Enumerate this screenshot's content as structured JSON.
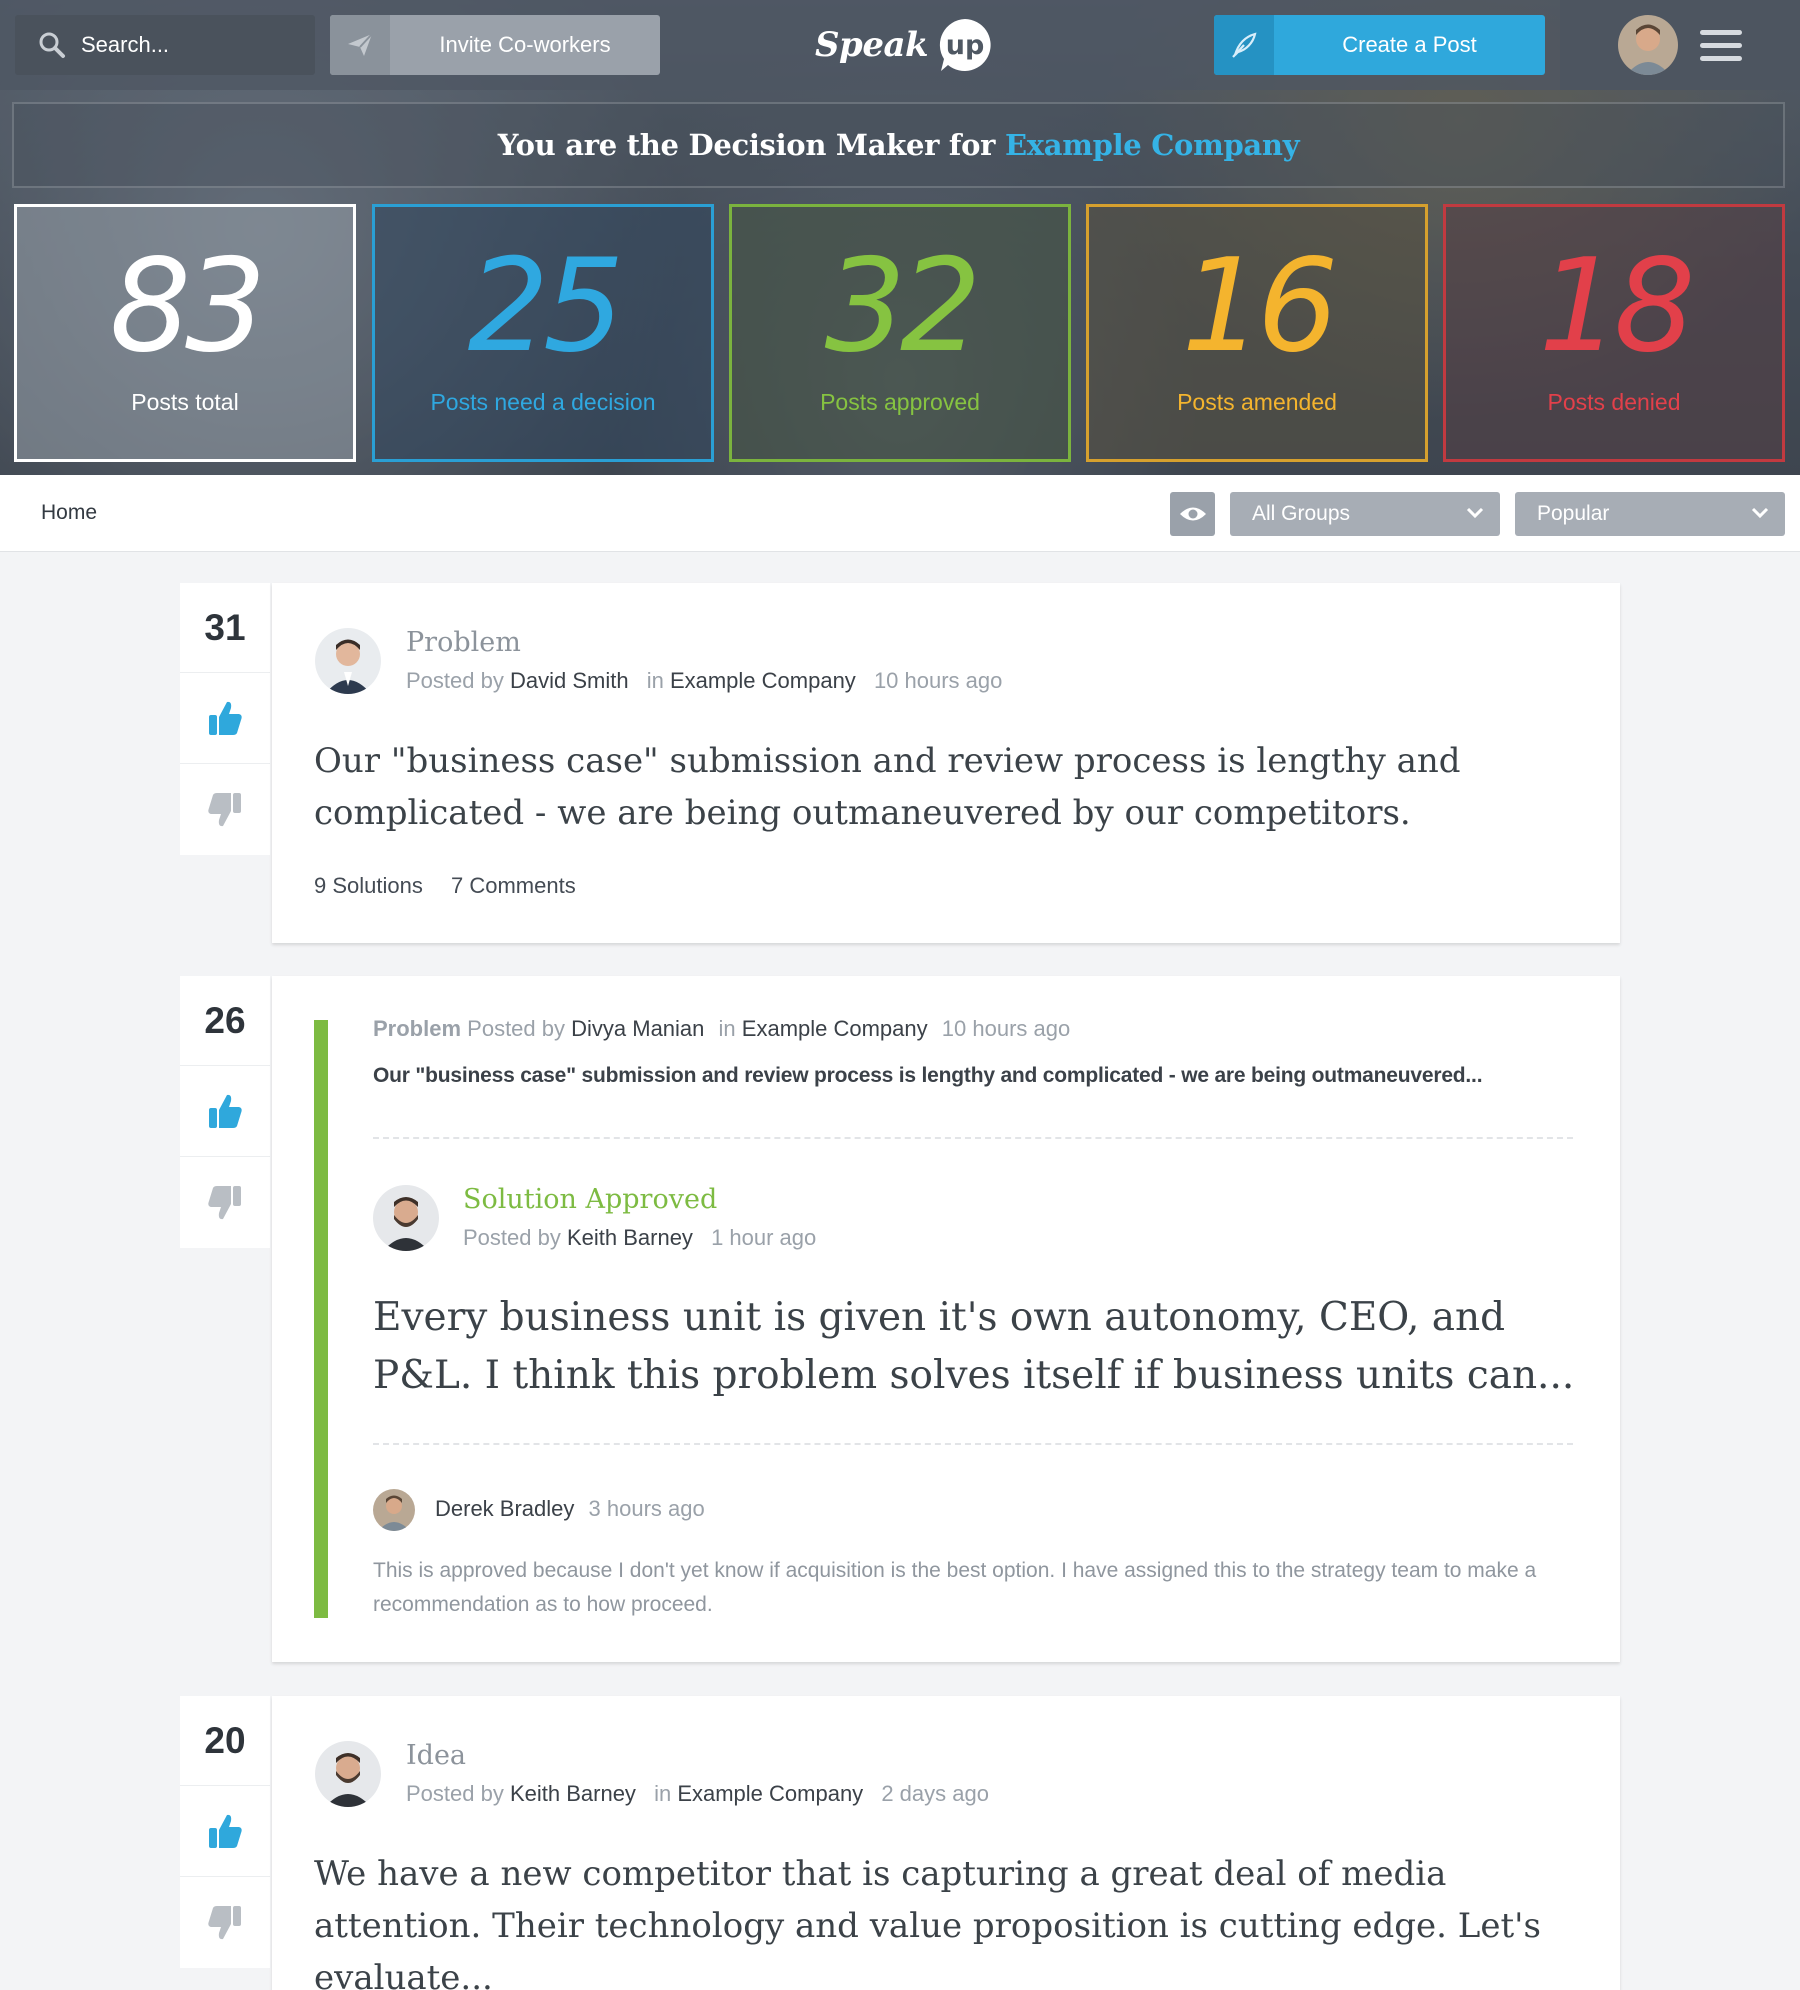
{
  "topbar": {
    "search_placeholder": "Search...",
    "invite_label": "Invite Co-workers",
    "logo_text": "Speak",
    "logo_badge": "up",
    "create_label": "Create a Post"
  },
  "banner": {
    "prefix": "You are the Decision Maker for",
    "company": "Example Company"
  },
  "stats": [
    {
      "value": "83",
      "label": "Posts total",
      "color": "#ffffff"
    },
    {
      "value": "25",
      "label": "Posts need a decision",
      "color": "#2fa8e0"
    },
    {
      "value": "32",
      "label": "Posts approved",
      "color": "#86c341"
    },
    {
      "value": "16",
      "label": "Posts amended",
      "color": "#f4b42e"
    },
    {
      "value": "18",
      "label": "Posts denied",
      "color": "#e2404a"
    }
  ],
  "filterbar": {
    "breadcrumb": "Home",
    "group_select": "All Groups",
    "sort_select": "Popular"
  },
  "posts": [
    {
      "votes": "31",
      "type": "Problem",
      "posted_by_label": "Posted by",
      "author": "David Smith",
      "in_label": "in",
      "group": "Example Company",
      "time": "10 hours ago",
      "headline": "Our \"business case\" submission and review process is lengthy and complicated - we are being outmaneuvered by our competitors.",
      "solutions": "9 Solutions",
      "comments": "7 Comments"
    },
    {
      "votes": "26",
      "context": {
        "type": "Problem",
        "posted_by_label": "Posted by",
        "author": "Divya Manian",
        "in_label": "in",
        "group": "Example Company",
        "time": "10 hours ago",
        "title": "Our \"business case\" submission and review process is lengthy and complicated - we are being outmaneuvered..."
      },
      "solution": {
        "status": "Solution Approved",
        "posted_by_label": "Posted by",
        "author": "Keith Barney",
        "time": "1 hour ago",
        "headline": "Every business unit is given it's own autonomy, CEO, and P&L. I think this problem solves itself if business units can..."
      },
      "comment": {
        "author": "Derek Bradley",
        "time": "3 hours ago",
        "text": "This is approved because I don't yet know if acquisition is the best option. I have assigned this to the strategy team to make a recommendation as to how proceed."
      },
      "accent_color": "#7dbb42"
    },
    {
      "votes": "20",
      "type": "Idea",
      "posted_by_label": "Posted by",
      "author": "Keith Barney",
      "in_label": "in",
      "group": "Example Company",
      "time": "2 days ago",
      "headline": "We have a new competitor that is capturing a great deal of media attention. Their technology and value proposition is cutting edge. Let's evaluate..."
    }
  ],
  "icons": {
    "search": "search-icon",
    "invite": "paper-plane-icon",
    "create": "feather-pen-icon",
    "menu": "hamburger-menu-icon",
    "visibility": "eye-icon",
    "dropdown": "chevron-down-icon",
    "upvote": "thumbs-up-icon",
    "downvote": "thumbs-down-icon"
  },
  "colors": {
    "primary": "#2fa8dc",
    "approved": "#7dbb42",
    "amended": "#f4b42e",
    "denied": "#e2404a"
  }
}
